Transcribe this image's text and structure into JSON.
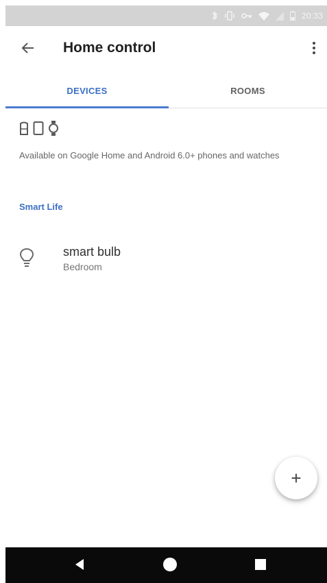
{
  "status_bar": {
    "time": "20:33",
    "icons": [
      "bluetooth-icon",
      "vibrate-icon",
      "vpn-key-icon",
      "wifi-icon",
      "signal-icon",
      "battery-icon"
    ]
  },
  "app_bar": {
    "title": "Home control",
    "back_icon": "arrow-left-icon",
    "more_icon": "more-vert-icon"
  },
  "tabs": [
    {
      "label": "DEVICES",
      "active": true
    },
    {
      "label": "ROOMS",
      "active": false
    }
  ],
  "availability": {
    "icons": [
      "google-home-icon",
      "phone-icon",
      "watch-icon"
    ],
    "text": "Available on Google Home and Android 6.0+ phones and watches"
  },
  "section": {
    "title": "Smart Life"
  },
  "devices": [
    {
      "name": "smart bulb",
      "room": "Bedroom",
      "icon": "lightbulb-icon"
    }
  ],
  "fab": {
    "label": "+"
  },
  "colors": {
    "accent": "#3b6fc4",
    "status_bar": "#d3d3d3",
    "nav_bar": "#0a0a0a"
  }
}
